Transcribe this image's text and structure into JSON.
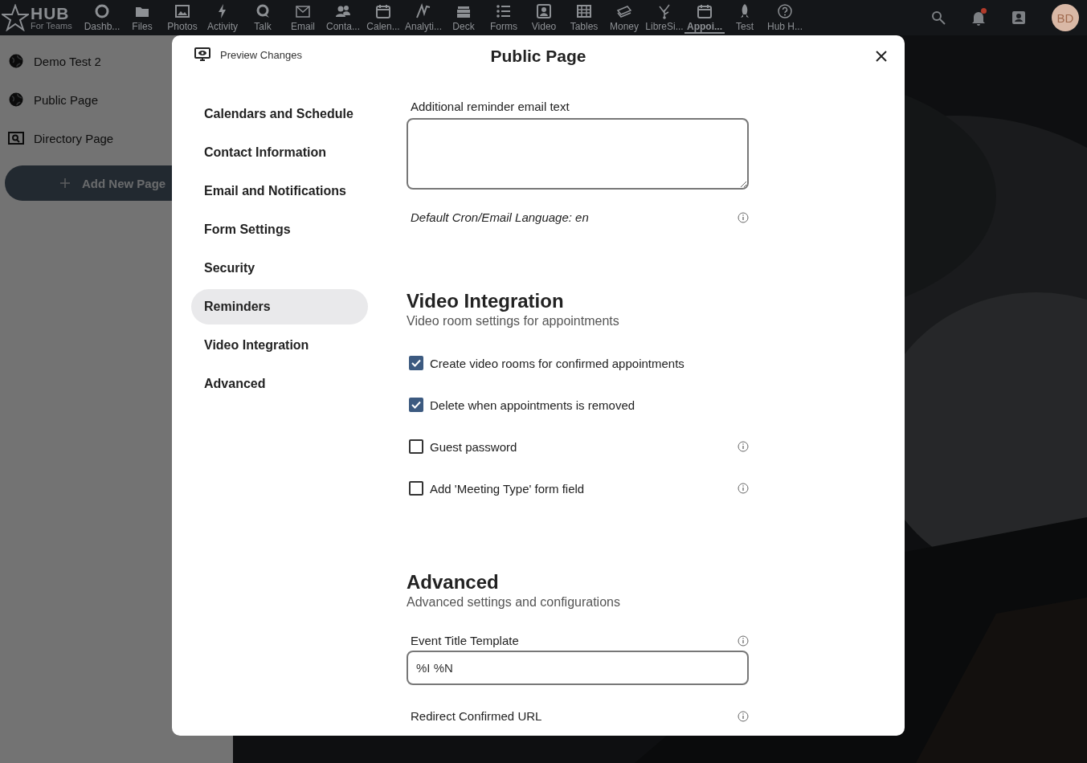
{
  "logo": {
    "title": "HUB",
    "subtitle": "For Teams"
  },
  "apps": [
    {
      "label": "Dashb...",
      "selected": false
    },
    {
      "label": "Files",
      "selected": false
    },
    {
      "label": "Photos",
      "selected": false
    },
    {
      "label": "Activity",
      "selected": false
    },
    {
      "label": "Talk",
      "selected": false
    },
    {
      "label": "Email",
      "selected": false
    },
    {
      "label": "Conta...",
      "selected": false
    },
    {
      "label": "Calen...",
      "selected": false
    },
    {
      "label": "Analyti...",
      "selected": false
    },
    {
      "label": "Deck",
      "selected": false
    },
    {
      "label": "Forms",
      "selected": false
    },
    {
      "label": "Video",
      "selected": false
    },
    {
      "label": "Tables",
      "selected": false
    },
    {
      "label": "Money",
      "selected": false
    },
    {
      "label": "LibreSi...",
      "selected": false
    },
    {
      "label": "Appoi...",
      "selected": true
    },
    {
      "label": "Test",
      "selected": false
    },
    {
      "label": "Hub H...",
      "selected": false
    }
  ],
  "user": {
    "initials": "BD",
    "notification": true
  },
  "sidebar": {
    "items": [
      {
        "label": "Demo Test 2"
      },
      {
        "label": "Public Page"
      },
      {
        "label": "Directory Page"
      }
    ],
    "add_button": "Add New Page"
  },
  "modal": {
    "title": "Public Page",
    "preview": "Preview Changes",
    "nav": [
      {
        "label": "Calendars and Schedule",
        "selected": false
      },
      {
        "label": "Contact Information",
        "selected": false
      },
      {
        "label": "Email and Notifications",
        "selected": false
      },
      {
        "label": "Form Settings",
        "selected": false
      },
      {
        "label": "Security",
        "selected": false
      },
      {
        "label": "Reminders",
        "selected": true
      },
      {
        "label": "Video Integration",
        "selected": false
      },
      {
        "label": "Advanced",
        "selected": false
      }
    ],
    "reminder_text": {
      "label": "Additional reminder email text"
    },
    "language_note": "Default Cron/Email Language: en",
    "video": {
      "title": "Video Integration",
      "subtitle": "Video room settings for appointments",
      "options": [
        {
          "label": "Create video rooms for confirmed appointments",
          "checked": true,
          "info": false
        },
        {
          "label": "Delete when appointments is removed",
          "checked": true,
          "info": false
        },
        {
          "label": "Guest password",
          "checked": false,
          "info": true
        },
        {
          "label": "Add 'Meeting Type' form field",
          "checked": false,
          "info": true
        }
      ]
    },
    "advanced": {
      "title": "Advanced",
      "subtitle": "Advanced settings and configurations",
      "fields": [
        {
          "label": "Event Title Template",
          "value": "%I %N"
        },
        {
          "label": "Redirect Confirmed URL"
        }
      ]
    }
  }
}
